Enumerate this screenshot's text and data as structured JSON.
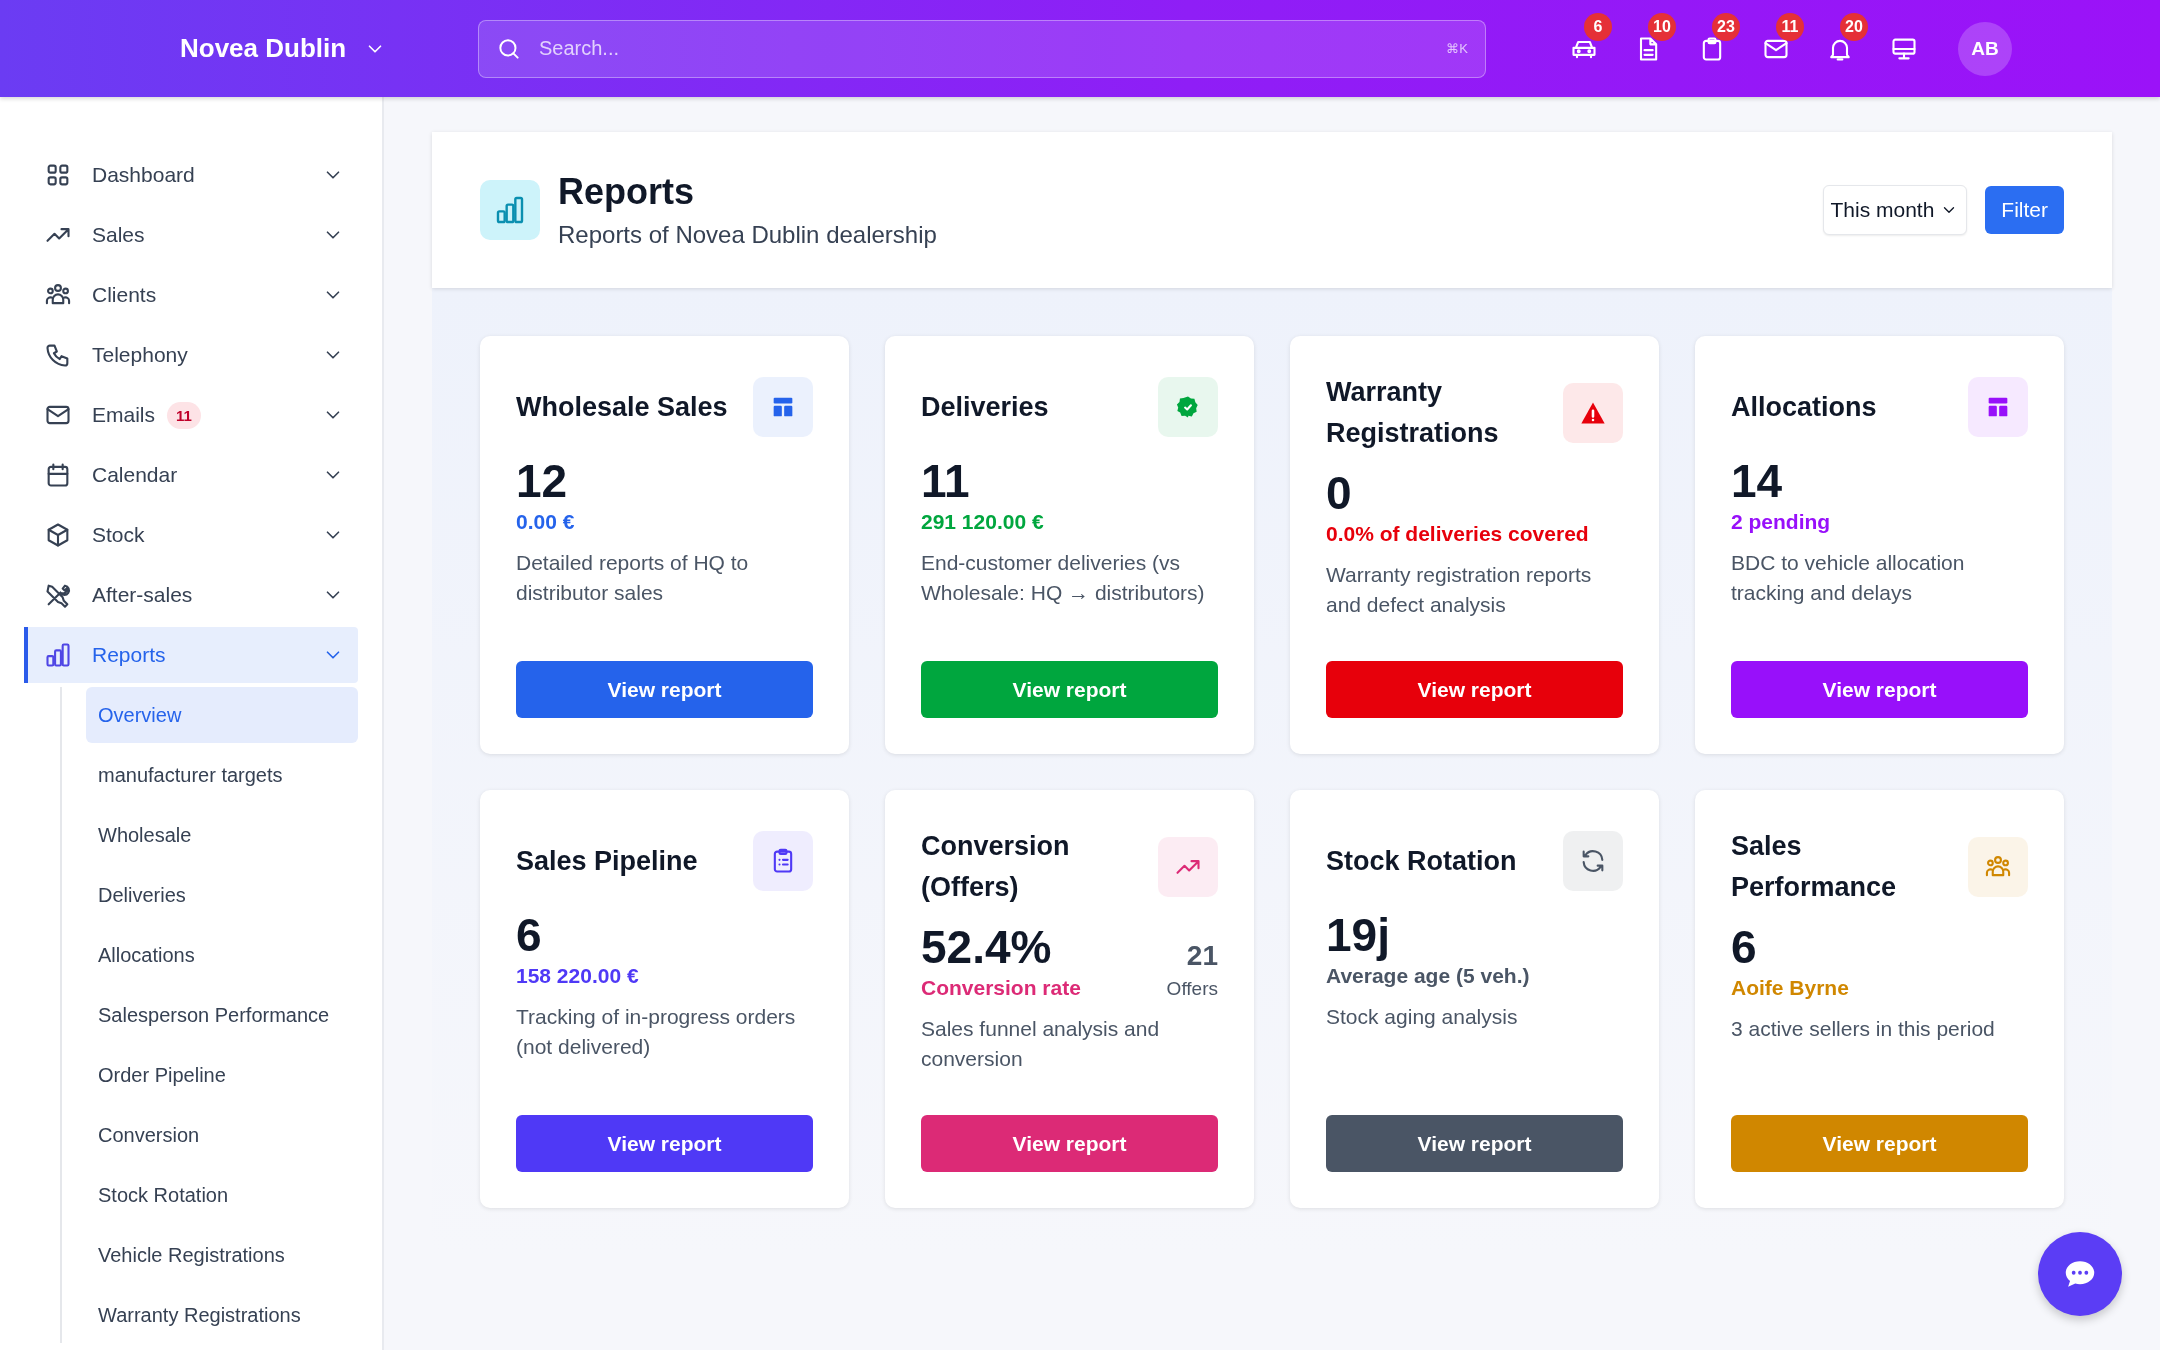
{
  "brand": {
    "name": "Novea Dublin"
  },
  "search": {
    "placeholder": "Search...",
    "shortcut": "⌘K"
  },
  "top_icons": [
    {
      "badge": "6"
    },
    {
      "badge": "10"
    },
    {
      "badge": "23"
    },
    {
      "badge": "11"
    },
    {
      "badge": "20"
    }
  ],
  "avatar": "AB",
  "sidebar": {
    "items": [
      {
        "label": "Dashboard",
        "selected": false
      },
      {
        "label": "Sales",
        "selected": false
      },
      {
        "label": "Clients",
        "selected": false
      },
      {
        "label": "Telephony",
        "selected": false
      },
      {
        "label": "Emails",
        "badge": "11",
        "selected": false
      },
      {
        "label": "Calendar",
        "selected": false
      },
      {
        "label": "Stock",
        "selected": false
      },
      {
        "label": "After-sales",
        "selected": false
      },
      {
        "label": "Reports",
        "selected": true,
        "children": [
          {
            "label": "Overview",
            "selected": true
          },
          {
            "label": "manufacturer targets",
            "selected": false
          },
          {
            "label": "Wholesale",
            "selected": false
          },
          {
            "label": "Deliveries",
            "selected": false
          },
          {
            "label": "Allocations",
            "selected": false
          },
          {
            "label": "Salesperson Performance",
            "selected": false
          },
          {
            "label": "Order Pipeline",
            "selected": false
          },
          {
            "label": "Conversion",
            "selected": false
          },
          {
            "label": "Stock Rotation",
            "selected": false
          },
          {
            "label": "Vehicle Registrations",
            "selected": false
          },
          {
            "label": "Warranty Registrations",
            "selected": false
          }
        ]
      }
    ]
  },
  "page_header": {
    "title": "Reports",
    "subtitle": "Reports of Novea Dublin dealership",
    "period": "This month",
    "filter_button": "Filter"
  },
  "cards": [
    {
      "kind": "standard",
      "title": "Wholesale Sales",
      "value": "12",
      "detail": "0.00 €",
      "description": "Detailed reports of HQ to distributor sales",
      "button": "View report",
      "color": "#2563eb"
    },
    {
      "kind": "standard",
      "title": "Deliveries",
      "value": "11",
      "detail": "291 120.00 €",
      "description": "End-customer deliveries (vs Wholesale: HQ → distributors)",
      "button": "View report",
      "color": "#00a63e"
    },
    {
      "kind": "standard",
      "title": "Warranty Registrations",
      "value": "0",
      "detail": "0.0% of deliveries covered",
      "description": "Warranty registration reports and defect analysis",
      "button": "View report",
      "color": "#e7000b"
    },
    {
      "kind": "standard",
      "title": "Allocations",
      "value": "14",
      "detail": "2 pending",
      "description": "BDC to vehicle allocation tracking and delays",
      "button": "View report",
      "color": "#9810fa"
    },
    {
      "kind": "standard",
      "title": "Sales Pipeline",
      "value": "6",
      "detail": "158 220.00 €",
      "description": "Tracking of in-progress orders (not delivered)",
      "button": "View report",
      "color": "#4f39f6"
    },
    {
      "kind": "split",
      "title": "Conversion (Offers)",
      "value": "52.4%",
      "detail": "Conversion rate",
      "side_value": "21",
      "side_label": "Offers",
      "description": "Sales funnel analysis and conversion",
      "button": "View report",
      "color": "#dc2a76"
    },
    {
      "kind": "standard",
      "title": "Stock Rotation",
      "value": "19j",
      "detail": "Average age (5 veh.)",
      "description": "Stock aging analysis",
      "button": "View report",
      "color": "#4a5565"
    },
    {
      "kind": "standard",
      "title": "Sales Performance",
      "value": "6",
      "detail": "Aoife Byrne",
      "description": "3 active sellers in this period",
      "button": "View report",
      "color": "#d08700"
    }
  ]
}
